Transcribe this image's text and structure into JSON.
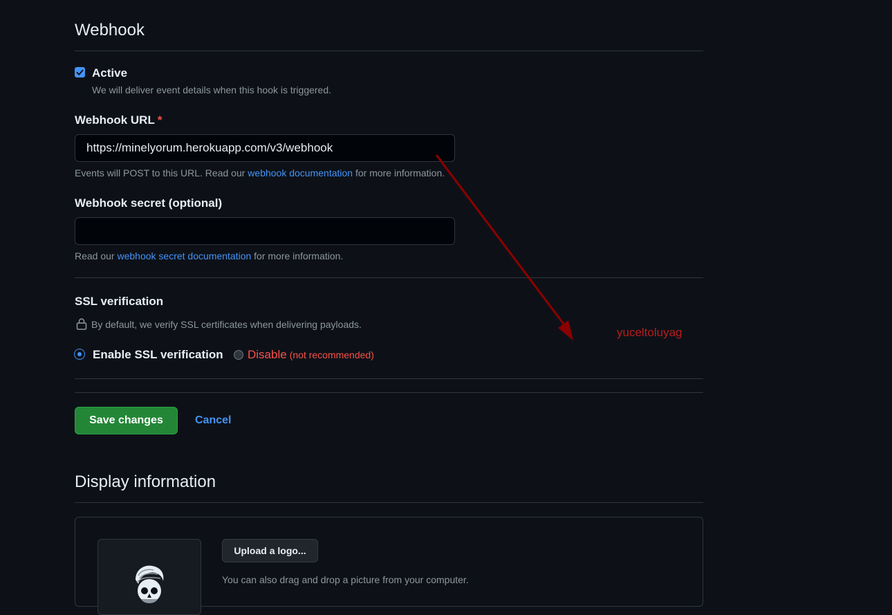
{
  "webhook": {
    "title": "Webhook",
    "active": {
      "label": "Active",
      "checked": true,
      "description": "We will deliver event details when this hook is triggered."
    },
    "url": {
      "label": "Webhook URL",
      "required_mark": "*",
      "value": "https://minelyorum.herokuapp.com/v3/webhook",
      "note_prefix": "Events will POST to this URL. Read our ",
      "note_link": "webhook documentation",
      "note_suffix": " for more information."
    },
    "secret": {
      "label": "Webhook secret (optional)",
      "value": "",
      "note_prefix": "Read our ",
      "note_link": "webhook secret documentation",
      "note_suffix": " for more information."
    },
    "ssl": {
      "label": "SSL verification",
      "description": "By default, we verify SSL certificates when delivering payloads.",
      "enable_label": "Enable SSL verification",
      "disable_label": "Disable",
      "disable_note": "(not recommended)",
      "selected": "enable"
    }
  },
  "actions": {
    "save_label": "Save changes",
    "cancel_label": "Cancel"
  },
  "display": {
    "title": "Display information",
    "upload_label": "Upload a logo...",
    "upload_note": "You can also drag and drop a picture from your computer."
  },
  "overlay": {
    "watermark": "yuceltoluyag",
    "arrow_color": "#8b0000"
  },
  "colors": {
    "background": "#0d1117",
    "accent": "#4493f8",
    "danger": "#f85149",
    "primary_button": "#238636"
  }
}
